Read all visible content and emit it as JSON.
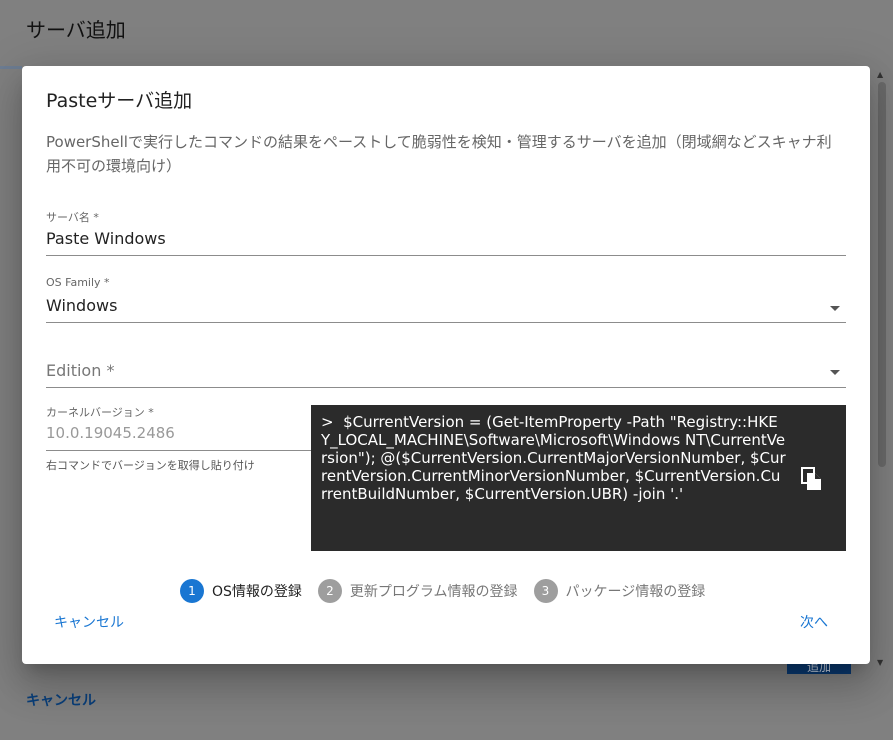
{
  "background": {
    "title": "サーバ追加",
    "cancel_label": "キャンセル",
    "add_label": "追加"
  },
  "dialog": {
    "title": "Pasteサーバ追加",
    "description": "PowerShellで実行したコマンドの結果をペーストして脆弱性を検知・管理するサーバを追加（閉域網などスキャナ利用不可の環境向け）",
    "server_name": {
      "label": "サーバ名 *",
      "value": "Paste Windows"
    },
    "os_family": {
      "label": "OS Family *",
      "value": "Windows"
    },
    "edition": {
      "placeholder": "Edition *",
      "value": ""
    },
    "kernel_version": {
      "label": "カーネルバージョン *",
      "placeholder": "10.0.19045.2486",
      "hint": "右コマンドでバージョンを取得し貼り付け"
    },
    "command": {
      "text": ">  $CurrentVersion = (Get-ItemProperty -Path \"Registry::HKEY_LOCAL_MACHINE\\Software\\Microsoft\\Windows NT\\CurrentVersion\"); @($CurrentVersion.CurrentMajorVersionNumber, $CurrentVersion.CurrentMinorVersionNumber, $CurrentVersion.CurrentBuildNumber, $CurrentVersion.UBR) -join '.'",
      "copy_icon": "copy-icon"
    },
    "steps": [
      {
        "num": "1",
        "label": "OS情報の登録",
        "state": "active"
      },
      {
        "num": "2",
        "label": "更新プログラム情報の登録",
        "state": "inactive"
      },
      {
        "num": "3",
        "label": "パッケージ情報の登録",
        "state": "inactive"
      }
    ],
    "cancel_label": "キャンセル",
    "next_label": "次へ"
  },
  "colors": {
    "primary": "#1976d2",
    "step_inactive": "#9e9e9e",
    "command_bg": "#2b2b2b",
    "overlay": "#808080"
  }
}
